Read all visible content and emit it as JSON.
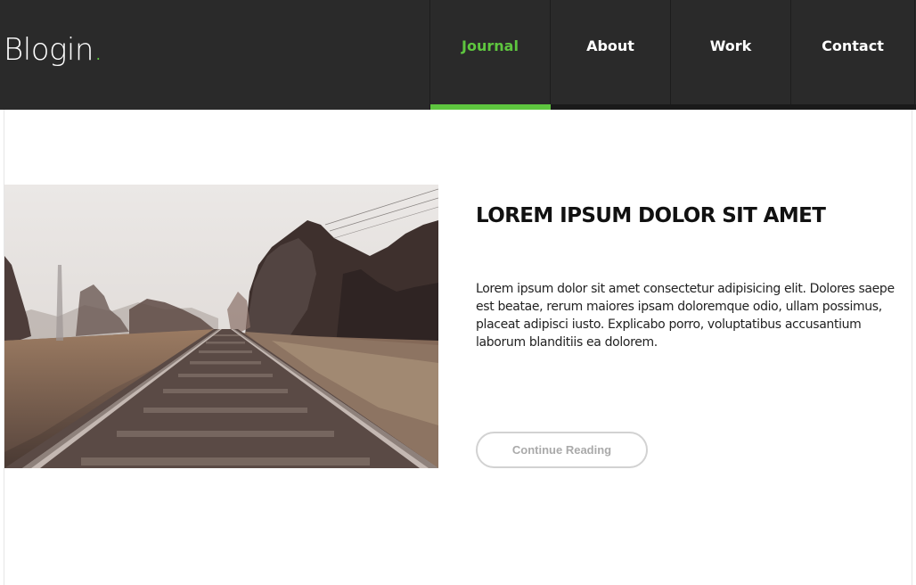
{
  "brand": {
    "logo_text": "Blogin",
    "logo_dot": ".",
    "accent_color": "#5ec63f",
    "header_bg": "#2a2a2a"
  },
  "nav": {
    "items": [
      {
        "label": "Journal",
        "active": true
      },
      {
        "label": "About",
        "active": false
      },
      {
        "label": "Work",
        "active": false
      },
      {
        "label": "Contact",
        "active": false
      }
    ]
  },
  "post": {
    "image_subject": "railway-tracks-photo",
    "title": "LOREM IPSUM DOLOR SIT AMET",
    "excerpt": "Lorem ipsum dolor sit amet consectetur adipisicing elit. Dolores saepe est beatae, rerum maiores ipsam doloremque odio, ullam possimus, placeat adipisci iusto. Explicabo porro, voluptatibus accusantium laborum blanditiis ea dolorem.",
    "cta_label": "Continue Reading"
  }
}
